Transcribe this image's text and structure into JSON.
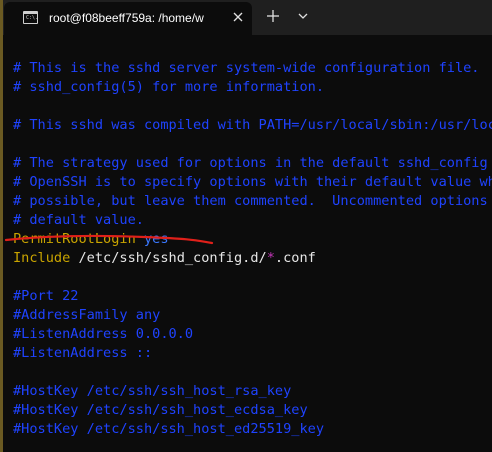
{
  "tab": {
    "title": "root@f08beeff759a: /home/w",
    "icon_glyph": "C:\\."
  },
  "buttons": {
    "close_glyph": "✕",
    "new_tab_glyph": "+",
    "dropdown_glyph": "⌄"
  },
  "terminal": {
    "lines": [
      "# This is the sshd server system-wide configuration file.",
      "# sshd_config(5) for more information.",
      "",
      "# This sshd was compiled with PATH=/usr/local/sbin:/usr/local/bin:/usr/sbin:/usr/bin:/sbin:/bin",
      "",
      "# The strategy used for options in the default sshd_config shipped with",
      "# OpenSSH is to specify options with their default value where",
      "# possible, but leave them commented.  Uncommented options override the",
      "# default value."
    ],
    "permit_key": "PermitRootLogin",
    "permit_value": "yes",
    "include_key": "Include",
    "include_path_prefix": "/etc/ssh/sshd_config.d/",
    "include_glob": "*",
    "include_suffix": ".conf",
    "lines2": [
      "",
      "#Port 22",
      "#AddressFamily any",
      "#ListenAddress 0.0.0.0",
      "#ListenAddress ::",
      "",
      "#HostKey /etc/ssh/ssh_host_rsa_key",
      "#HostKey /etc/ssh/ssh_host_ecdsa_key",
      "#HostKey /etc/ssh/ssh_host_ed25519_key"
    ]
  },
  "colors": {
    "background": "#0c0c0c",
    "comment": "#1f43ff",
    "keyword": "#c9a400",
    "value": "#3a78ff",
    "glob": "#c335b8",
    "annotation_underline": "#e0201a"
  }
}
